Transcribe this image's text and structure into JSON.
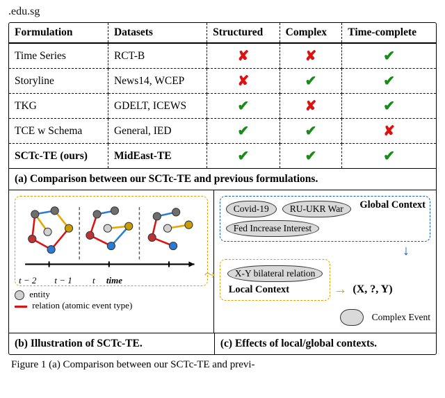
{
  "header_url": ".edu.sg",
  "chart_data": {
    "type": "table",
    "columns": [
      "Formulation",
      "Datasets",
      "Structured",
      "Complex",
      "Time-complete"
    ],
    "rows": [
      {
        "formulation": "Time Series",
        "datasets": "RCT-B",
        "structured": false,
        "complex": false,
        "time_complete": true
      },
      {
        "formulation": "Storyline",
        "datasets": "News14, WCEP",
        "structured": false,
        "complex": true,
        "time_complete": true
      },
      {
        "formulation": "TKG",
        "datasets": "GDELT, ICEWS",
        "structured": true,
        "complex": false,
        "time_complete": true
      },
      {
        "formulation": "TCE w Schema",
        "datasets": "General, IED",
        "structured": true,
        "complex": true,
        "time_complete": false
      },
      {
        "formulation": "SCTc-TE (ours)",
        "datasets": "MidEast-TE",
        "structured": true,
        "complex": true,
        "time_complete": true
      }
    ]
  },
  "marks": {
    "check": "✔",
    "cross": "✘"
  },
  "caption_a": "(a) Comparison between our SCTc-TE and previous formulations.",
  "panel_b": {
    "ticks": [
      "t − 2",
      "t − 1",
      "t"
    ],
    "axis_label": "time",
    "legend_entity": "entity",
    "legend_relation": "relation (atomic event type)"
  },
  "caption_b": "(b) Illustration of SCTc-TE.",
  "panel_c": {
    "global_clouds": [
      "Covid-19",
      "RU-UKR War",
      "Fed Increase Interest"
    ],
    "global_label": "Global Context",
    "local_cloud": "X-Y bilateral relation",
    "local_label": "Local Context",
    "target": "(X, ?, Y)",
    "complex_label": "Complex Event"
  },
  "caption_c": "(c) Effects of local/global contexts.",
  "fig_caption_prefix": "Figure 1 (a) Comparison between our SCTc-TE and previ-"
}
